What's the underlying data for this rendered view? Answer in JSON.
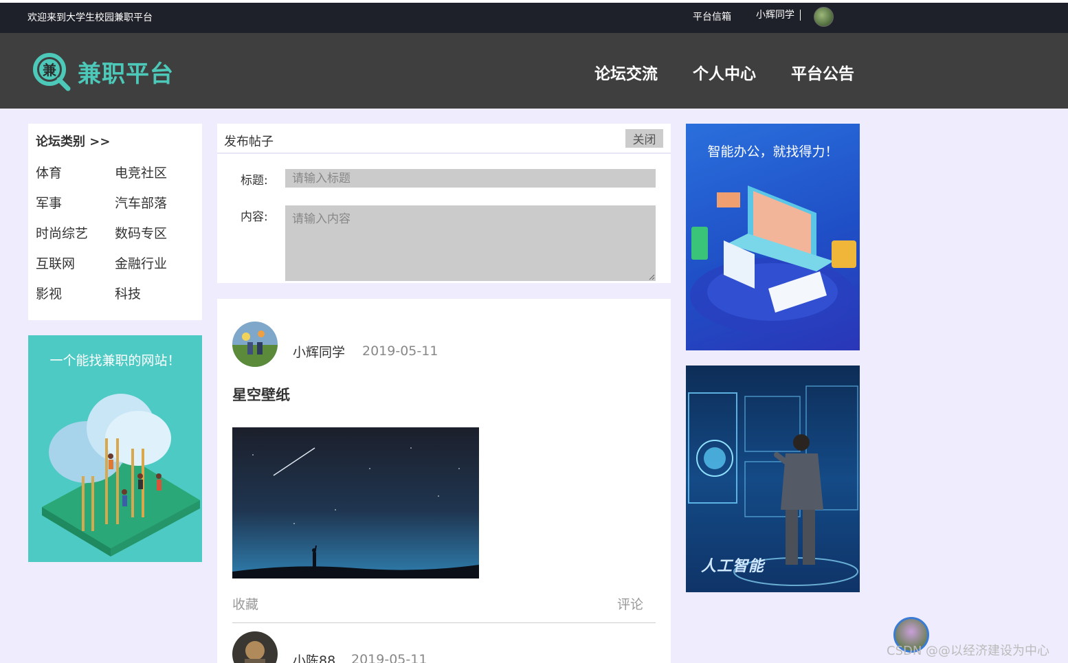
{
  "topbar": {
    "welcome": "欢迎来到大学生校园兼职平台",
    "mailbox": "平台信箱",
    "username": "小辉同学"
  },
  "header": {
    "logo_char": "兼",
    "logo_text": "兼职平台",
    "nav": [
      "论坛交流",
      "个人中心",
      "平台公告"
    ]
  },
  "categories": {
    "title": "论坛类别 >>",
    "items": [
      "体育",
      "电竞社区",
      "军事",
      "汽车部落",
      "时尚综艺",
      "数码专区",
      "互联网",
      "金融行业",
      "影视",
      "科技"
    ]
  },
  "ads": {
    "left_text": "一个能找兼职的网站！",
    "right1_text": "智能办公，就找得力！",
    "right2_text": "人工智能"
  },
  "post_form": {
    "title": "发布帖子",
    "close_label": "关闭",
    "title_label": "标题:",
    "title_placeholder": "请输入标题",
    "content_label": "内容:",
    "content_placeholder": "请输入内容"
  },
  "posts": [
    {
      "author": "小辉同学",
      "date": "2019-05-11",
      "title": "星空壁纸",
      "favorite_label": "收藏",
      "comment_label": "评论"
    },
    {
      "author": "小陈88",
      "date": "2019-05-11"
    }
  ],
  "watermark": "CSDN @@以经济建设为中心",
  "colors": {
    "topbar_bg": "#1e2129",
    "header_bg": "#3f3f3f",
    "brand": "#4cc9b9",
    "page_bg": "#efedfd"
  }
}
